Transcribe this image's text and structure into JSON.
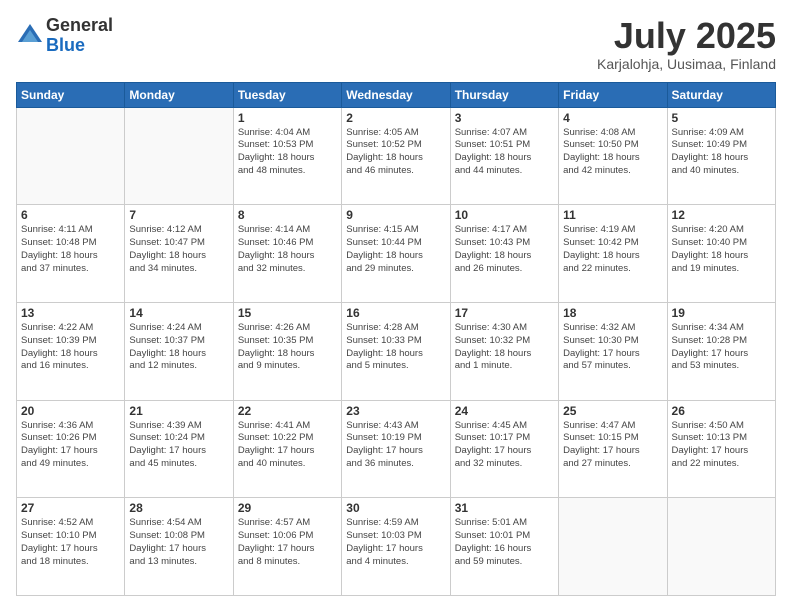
{
  "header": {
    "logo_line1": "General",
    "logo_line2": "Blue",
    "month": "July 2025",
    "location": "Karjalohja, Uusimaa, Finland"
  },
  "weekdays": [
    "Sunday",
    "Monday",
    "Tuesday",
    "Wednesday",
    "Thursday",
    "Friday",
    "Saturday"
  ],
  "weeks": [
    [
      {
        "day": "",
        "info": ""
      },
      {
        "day": "",
        "info": ""
      },
      {
        "day": "1",
        "info": "Sunrise: 4:04 AM\nSunset: 10:53 PM\nDaylight: 18 hours\nand 48 minutes."
      },
      {
        "day": "2",
        "info": "Sunrise: 4:05 AM\nSunset: 10:52 PM\nDaylight: 18 hours\nand 46 minutes."
      },
      {
        "day": "3",
        "info": "Sunrise: 4:07 AM\nSunset: 10:51 PM\nDaylight: 18 hours\nand 44 minutes."
      },
      {
        "day": "4",
        "info": "Sunrise: 4:08 AM\nSunset: 10:50 PM\nDaylight: 18 hours\nand 42 minutes."
      },
      {
        "day": "5",
        "info": "Sunrise: 4:09 AM\nSunset: 10:49 PM\nDaylight: 18 hours\nand 40 minutes."
      }
    ],
    [
      {
        "day": "6",
        "info": "Sunrise: 4:11 AM\nSunset: 10:48 PM\nDaylight: 18 hours\nand 37 minutes."
      },
      {
        "day": "7",
        "info": "Sunrise: 4:12 AM\nSunset: 10:47 PM\nDaylight: 18 hours\nand 34 minutes."
      },
      {
        "day": "8",
        "info": "Sunrise: 4:14 AM\nSunset: 10:46 PM\nDaylight: 18 hours\nand 32 minutes."
      },
      {
        "day": "9",
        "info": "Sunrise: 4:15 AM\nSunset: 10:44 PM\nDaylight: 18 hours\nand 29 minutes."
      },
      {
        "day": "10",
        "info": "Sunrise: 4:17 AM\nSunset: 10:43 PM\nDaylight: 18 hours\nand 26 minutes."
      },
      {
        "day": "11",
        "info": "Sunrise: 4:19 AM\nSunset: 10:42 PM\nDaylight: 18 hours\nand 22 minutes."
      },
      {
        "day": "12",
        "info": "Sunrise: 4:20 AM\nSunset: 10:40 PM\nDaylight: 18 hours\nand 19 minutes."
      }
    ],
    [
      {
        "day": "13",
        "info": "Sunrise: 4:22 AM\nSunset: 10:39 PM\nDaylight: 18 hours\nand 16 minutes."
      },
      {
        "day": "14",
        "info": "Sunrise: 4:24 AM\nSunset: 10:37 PM\nDaylight: 18 hours\nand 12 minutes."
      },
      {
        "day": "15",
        "info": "Sunrise: 4:26 AM\nSunset: 10:35 PM\nDaylight: 18 hours\nand 9 minutes."
      },
      {
        "day": "16",
        "info": "Sunrise: 4:28 AM\nSunset: 10:33 PM\nDaylight: 18 hours\nand 5 minutes."
      },
      {
        "day": "17",
        "info": "Sunrise: 4:30 AM\nSunset: 10:32 PM\nDaylight: 18 hours\nand 1 minute."
      },
      {
        "day": "18",
        "info": "Sunrise: 4:32 AM\nSunset: 10:30 PM\nDaylight: 17 hours\nand 57 minutes."
      },
      {
        "day": "19",
        "info": "Sunrise: 4:34 AM\nSunset: 10:28 PM\nDaylight: 17 hours\nand 53 minutes."
      }
    ],
    [
      {
        "day": "20",
        "info": "Sunrise: 4:36 AM\nSunset: 10:26 PM\nDaylight: 17 hours\nand 49 minutes."
      },
      {
        "day": "21",
        "info": "Sunrise: 4:39 AM\nSunset: 10:24 PM\nDaylight: 17 hours\nand 45 minutes."
      },
      {
        "day": "22",
        "info": "Sunrise: 4:41 AM\nSunset: 10:22 PM\nDaylight: 17 hours\nand 40 minutes."
      },
      {
        "day": "23",
        "info": "Sunrise: 4:43 AM\nSunset: 10:19 PM\nDaylight: 17 hours\nand 36 minutes."
      },
      {
        "day": "24",
        "info": "Sunrise: 4:45 AM\nSunset: 10:17 PM\nDaylight: 17 hours\nand 32 minutes."
      },
      {
        "day": "25",
        "info": "Sunrise: 4:47 AM\nSunset: 10:15 PM\nDaylight: 17 hours\nand 27 minutes."
      },
      {
        "day": "26",
        "info": "Sunrise: 4:50 AM\nSunset: 10:13 PM\nDaylight: 17 hours\nand 22 minutes."
      }
    ],
    [
      {
        "day": "27",
        "info": "Sunrise: 4:52 AM\nSunset: 10:10 PM\nDaylight: 17 hours\nand 18 minutes."
      },
      {
        "day": "28",
        "info": "Sunrise: 4:54 AM\nSunset: 10:08 PM\nDaylight: 17 hours\nand 13 minutes."
      },
      {
        "day": "29",
        "info": "Sunrise: 4:57 AM\nSunset: 10:06 PM\nDaylight: 17 hours\nand 8 minutes."
      },
      {
        "day": "30",
        "info": "Sunrise: 4:59 AM\nSunset: 10:03 PM\nDaylight: 17 hours\nand 4 minutes."
      },
      {
        "day": "31",
        "info": "Sunrise: 5:01 AM\nSunset: 10:01 PM\nDaylight: 16 hours\nand 59 minutes."
      },
      {
        "day": "",
        "info": ""
      },
      {
        "day": "",
        "info": ""
      }
    ]
  ]
}
